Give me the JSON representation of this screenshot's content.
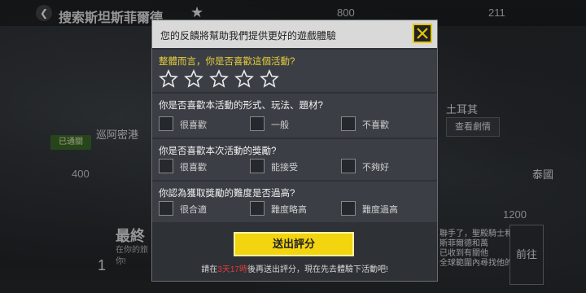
{
  "background": {
    "title": "搜索斯坦斯菲爾德",
    "back_icon": "back-arrow-icon",
    "currency_left": "800",
    "currency_right": "211",
    "map_label_1": "巡阿密港",
    "map_label_2": "土耳其",
    "map_label_3": "泰國",
    "cost_1": "400",
    "cost_2": "1200",
    "badge": "已通關",
    "story_button": "查看劇情",
    "go_button": "前往",
    "final_title": "最終",
    "final_sub": "在你的旅",
    "final_sub2": "你!",
    "count": "1",
    "side_text_1": "聯手了，聖殿騎士和",
    "side_text_2": "斯菲爾德和萬",
    "side_text_3": "已收到有關他",
    "side_text_4": "全球範圍內尋找他的"
  },
  "modal": {
    "header": "您的反饋將幫助我們提供更好的遊戲體驗",
    "close_icon": "close-x-icon",
    "q1": "整體而言，你是否喜歡這個活動?",
    "stars": [
      "1",
      "2",
      "3",
      "4",
      "5"
    ],
    "q2": "你是否喜歡本活動的形式、玩法、題材?",
    "q2_options": [
      "很喜歡",
      "一般",
      "不喜歡"
    ],
    "q3": "你是否喜歡本次活動的獎勵?",
    "q3_options": [
      "很喜歡",
      "能接受",
      "不夠好"
    ],
    "q4": "你認為獲取獎勵的難度是否過高?",
    "q4_options": [
      "很合適",
      "難度略高",
      "難度過高"
    ],
    "submit": "送出評分",
    "footer_pre": "請在",
    "footer_time": "3天17時",
    "footer_post": "後再送出評分，現在先去體驗下活動吧!"
  },
  "colors": {
    "accent": "#f2d40f",
    "highlight": "#e8cd3a",
    "warning": "#e23b3b"
  }
}
